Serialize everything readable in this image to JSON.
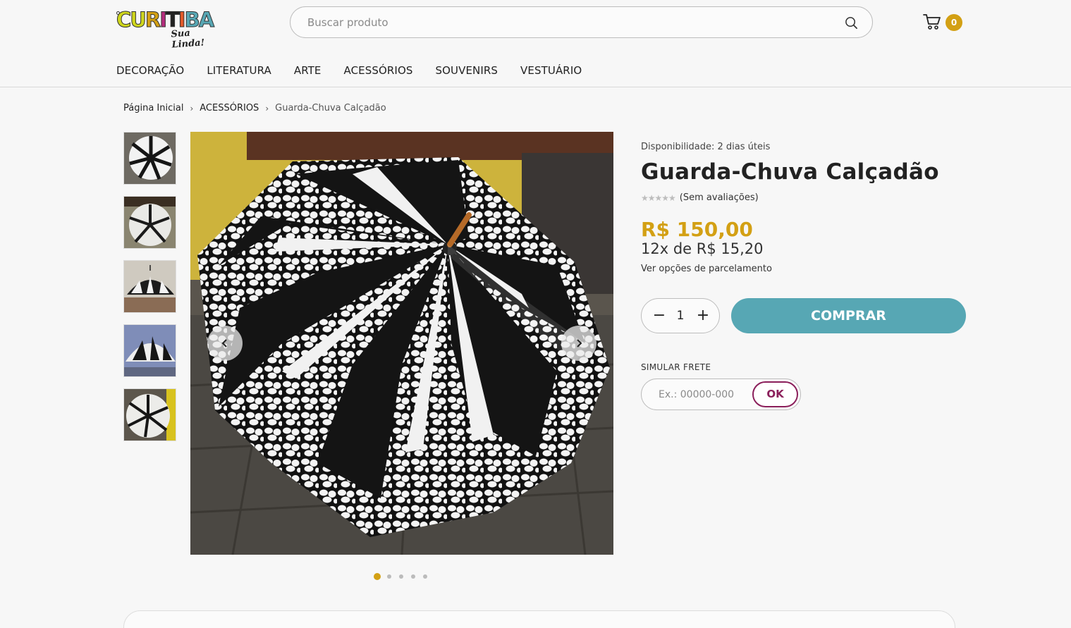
{
  "brand": {
    "logo_letters": [
      "C",
      "U",
      "R",
      "I",
      "T",
      "I",
      "B",
      "A"
    ],
    "logo_tagline": "Sua Linda!",
    "colors": [
      "#cfd61c",
      "#d3a014",
      "#b52c7d",
      "#57a7b4",
      "#e05a2a"
    ]
  },
  "search": {
    "placeholder": "Buscar produto",
    "icon": "search-icon"
  },
  "cart": {
    "icon": "cart-icon",
    "count": "0"
  },
  "nav": {
    "items": [
      "DECORAÇÃO",
      "LITERATURA",
      "ARTE",
      "ACESSÓRIOS",
      "SOUVENIRS",
      "VESTUÁRIO"
    ]
  },
  "breadcrumb": {
    "home": "Página Inicial",
    "category": "ACESSÓRIOS",
    "current": "Guarda-Chuva Calçadão"
  },
  "gallery": {
    "thumbnail_count": 5,
    "active_slide": 1,
    "slides": 5
  },
  "product": {
    "availability": "Disponibilidade: 2 dias úteis",
    "title": "Guarda-Chuva Calçadão",
    "stars": "★★★★★",
    "reviews": "(Sem avaliações)",
    "price": "R$ 150,00",
    "installments": "12x de R$ 15,20",
    "installment_link": "Ver opções de parcelamento",
    "quantity": "1",
    "buy_label": "COMPRAR"
  },
  "shipping": {
    "label": "SIMULAR FRETE",
    "placeholder": "Ex.: 00000-000",
    "ok_label": "OK"
  },
  "theme": {
    "accent": "#d3a014",
    "buy_button": "#57a7b4",
    "ok_button": "#8b1f5b"
  }
}
